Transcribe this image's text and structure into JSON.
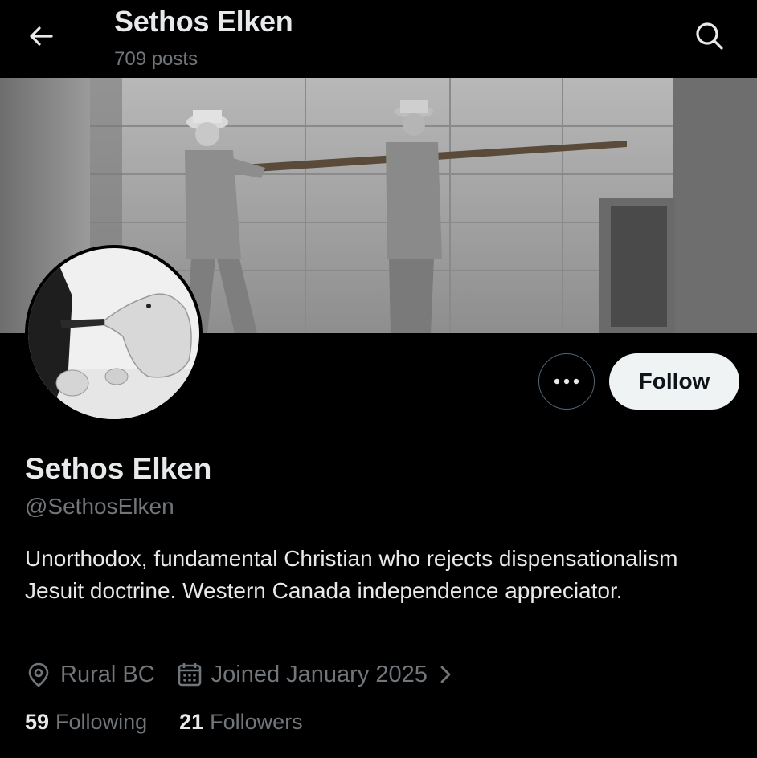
{
  "header": {
    "title": "Sethos Elken",
    "post_count": "709 posts"
  },
  "icons": {
    "back": "arrow-left-icon",
    "search": "search-icon",
    "more": "more-horizontal-icon",
    "location": "location-pin-icon",
    "joined": "calendar-icon",
    "expand": "chevron-right-icon"
  },
  "profile": {
    "display_name": "Sethos Elken",
    "handle": "@SethosElken",
    "bio": "Unorthodox, fundamental Christian who rejects dispensationalism Jesuit doctrine. Western Canada independence appreciator.",
    "location": "Rural BC",
    "joined": "Joined January 2025"
  },
  "actions": {
    "follow_label": "Follow"
  },
  "stats": {
    "following_count": "59",
    "following_label": "Following",
    "followers_count": "21",
    "followers_label": "Followers"
  },
  "colors": {
    "background": "#000000",
    "text_primary": "#e7e9ea",
    "text_secondary": "#71767b",
    "button_bg": "#eff3f4",
    "button_text": "#0f1419",
    "border": "#536471"
  }
}
